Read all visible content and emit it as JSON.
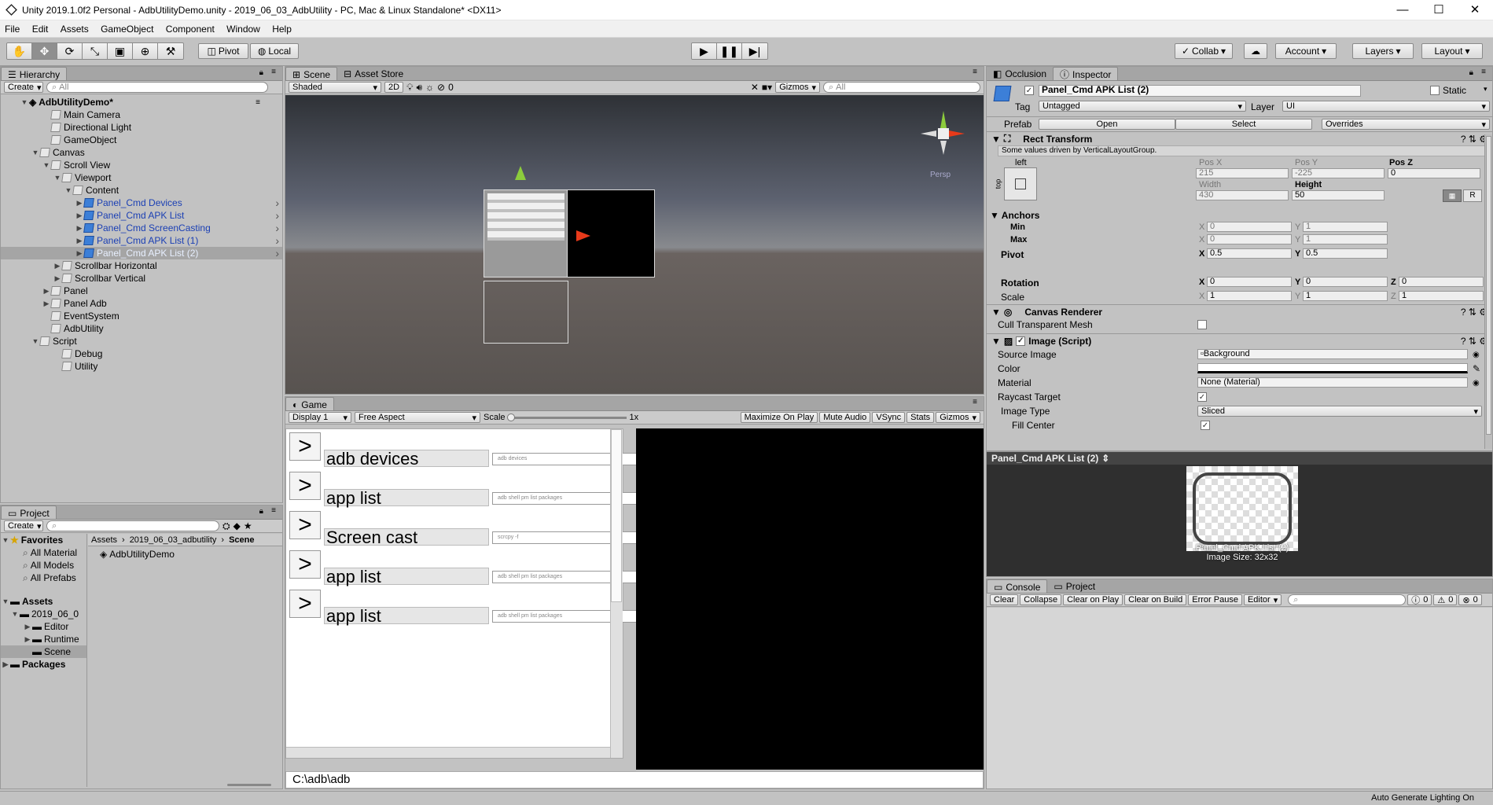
{
  "window": {
    "title": "Unity 2019.1.0f2 Personal - AdbUtilityDemo.unity - 2019_06_03_AdbUtility - PC, Mac & Linux Standalone* <DX11>",
    "minimize": "—",
    "maximize": "☐",
    "close": "✕"
  },
  "menu": [
    "File",
    "Edit",
    "Assets",
    "GameObject",
    "Component",
    "Window",
    "Help"
  ],
  "toolbar": {
    "pivot": "Pivot",
    "local": "Local",
    "collab": "Collab",
    "account": "Account",
    "layers": "Layers",
    "layout": "Layout"
  },
  "hierarchy": {
    "tab": "Hierarchy",
    "create": "Create",
    "search": "All",
    "scene_name": "AdbUtilityDemo*",
    "rows": [
      {
        "label": "Main Camera",
        "indent": 2,
        "arrow": "",
        "blue": false,
        "sel": false
      },
      {
        "label": "Directional Light",
        "indent": 2,
        "arrow": "",
        "blue": false,
        "sel": false
      },
      {
        "label": "GameObject",
        "indent": 2,
        "arrow": "",
        "blue": false,
        "sel": false
      },
      {
        "label": "Canvas",
        "indent": 1,
        "arrow": "▼",
        "blue": false,
        "sel": false
      },
      {
        "label": "Scroll View",
        "indent": 2,
        "arrow": "▼",
        "blue": false,
        "sel": false
      },
      {
        "label": "Viewport",
        "indent": 3,
        "arrow": "▼",
        "blue": false,
        "sel": false
      },
      {
        "label": "Content",
        "indent": 4,
        "arrow": "▼",
        "blue": false,
        "sel": false
      },
      {
        "label": "Panel_Cmd Devices",
        "indent": 5,
        "arrow": "▶",
        "blue": true,
        "sel": false
      },
      {
        "label": "Panel_Cmd APK List",
        "indent": 5,
        "arrow": "▶",
        "blue": true,
        "sel": false
      },
      {
        "label": "Panel_Cmd ScreenCasting",
        "indent": 5,
        "arrow": "▶",
        "blue": true,
        "sel": false
      },
      {
        "label": "Panel_Cmd APK List (1)",
        "indent": 5,
        "arrow": "▶",
        "blue": true,
        "sel": false
      },
      {
        "label": "Panel_Cmd APK List (2)",
        "indent": 5,
        "arrow": "▶",
        "blue": true,
        "sel": true
      },
      {
        "label": "Scrollbar Horizontal",
        "indent": 3,
        "arrow": "▶",
        "blue": false,
        "sel": false
      },
      {
        "label": "Scrollbar Vertical",
        "indent": 3,
        "arrow": "▶",
        "blue": false,
        "sel": false
      },
      {
        "label": "Panel",
        "indent": 2,
        "arrow": "▶",
        "blue": false,
        "sel": false
      },
      {
        "label": "Panel Adb",
        "indent": 2,
        "arrow": "▶",
        "blue": false,
        "sel": false
      },
      {
        "label": "EventSystem",
        "indent": 2,
        "arrow": "",
        "blue": false,
        "sel": false
      },
      {
        "label": "AdbUtility",
        "indent": 2,
        "arrow": "",
        "blue": false,
        "sel": false
      },
      {
        "label": "Script",
        "indent": 1,
        "arrow": "▼",
        "blue": false,
        "sel": false
      },
      {
        "label": "Debug",
        "indent": 3,
        "arrow": "",
        "blue": false,
        "sel": false
      },
      {
        "label": "Utility",
        "indent": 3,
        "arrow": "",
        "blue": false,
        "sel": false
      }
    ]
  },
  "scene": {
    "tab": "Scene",
    "tab2": "Asset Store",
    "shading": "Shaded",
    "mode2d": "2D",
    "fx_count": "0",
    "gizmos": "Gizmos",
    "search": "All",
    "persp": "Persp"
  },
  "game": {
    "tab": "Game",
    "display": "Display 1",
    "aspect": "Free Aspect",
    "scale_label": "Scale",
    "scale_value": "1x",
    "buttons": [
      "Maximize On Play",
      "Mute Audio",
      "VSync",
      "Stats",
      "Gizmos"
    ],
    "rows": [
      {
        "arrow": ">",
        "label": "adb devices",
        "cmd": "adb devices"
      },
      {
        "arrow": ">",
        "label": "app list",
        "cmd": "adb shell pm list packages"
      },
      {
        "arrow": ">",
        "label": "Screen cast",
        "cmd": "scrcpy -f"
      },
      {
        "arrow": ">",
        "label": "app list",
        "cmd": "adb shell pm list packages"
      },
      {
        "arrow": ">",
        "label": "app list",
        "cmd": "adb shell pm list packages"
      }
    ],
    "path": "C:\\adb\\adb"
  },
  "project": {
    "tab": "Project",
    "create": "Create",
    "favorites": "Favorites",
    "fav_items": [
      "All Material",
      "All Models",
      "All Prefabs"
    ],
    "assets": "Assets",
    "tree": [
      "2019_06_0",
      "Editor",
      "Runtime",
      "Scene"
    ],
    "packages": "Packages",
    "breadcrumb": [
      "Assets",
      "2019_06_03_adbutility",
      "Scene"
    ],
    "file": "AdbUtilityDemo"
  },
  "inspector": {
    "tab_occlusion": "Occlusion",
    "tab": "Inspector",
    "name": "Panel_Cmd APK List (2)",
    "static": "Static",
    "tag_label": "Tag",
    "tag": "Untagged",
    "layer_label": "Layer",
    "layer": "UI",
    "prefab_label": "Prefab",
    "open": "Open",
    "select": "Select",
    "overrides": "Overrides",
    "rect_title": "Rect Transform",
    "rect_note": "Some values driven by VerticalLayoutGroup.",
    "anchor_h": "left",
    "anchor_v": "top",
    "posx_label": "Pos X",
    "posx": "215",
    "posy_label": "Pos Y",
    "posy": "-225",
    "posz_label": "Pos Z",
    "posz": "0",
    "width_label": "Width",
    "width": "430",
    "height_label": "Height",
    "height": "50",
    "r_btn": "R",
    "anchors": "Anchors",
    "min": "Min",
    "max": "Max",
    "min_x": "0",
    "min_y": "1",
    "max_x": "0",
    "max_y": "1",
    "pivot": "Pivot",
    "pivot_x": "0.5",
    "pivot_y": "0.5",
    "rotation": "Rotation",
    "rot_x": "0",
    "rot_y": "0",
    "rot_z": "0",
    "scale": "Scale",
    "scale_x": "1",
    "scale_y": "1",
    "scale_z": "1",
    "axis_x": "X",
    "axis_y": "Y",
    "axis_z": "Z",
    "canvas_renderer": "Canvas Renderer",
    "cull": "Cull Transparent Mesh",
    "image_script": "Image (Script)",
    "source_image_label": "Source Image",
    "source_image": "Background",
    "color_label": "Color",
    "material_label": "Material",
    "material": "None (Material)",
    "raycast_label": "Raycast Target",
    "image_type_label": "Image Type",
    "image_type": "Sliced",
    "fill_center_label": "Fill Center",
    "preview_title": "Panel_Cmd APK List (2)",
    "preview_caption1": "Panel_Cmd APK List (2)",
    "preview_caption2": "Image Size: 32x32"
  },
  "console": {
    "tab": "Console",
    "tab2": "Project",
    "buttons": [
      "Clear",
      "Collapse",
      "Clear on Play",
      "Clear on Build",
      "Error Pause",
      "Editor"
    ],
    "count_info": "0",
    "count_warn": "0",
    "count_err": "0"
  },
  "status": {
    "text": "Auto Generate Lighting On"
  }
}
